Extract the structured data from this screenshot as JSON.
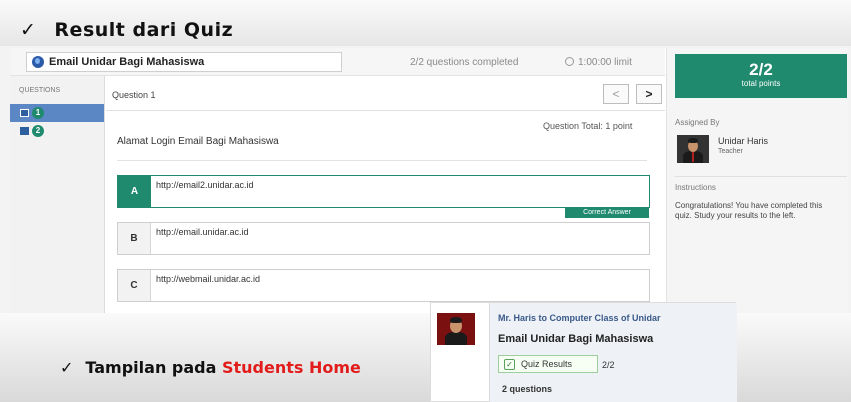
{
  "slide": {
    "check_glyph": "✓",
    "title": "Result dari Quiz",
    "bottom_caption_prefix": "Tampilan pada ",
    "bottom_caption_highlight": "Students Home"
  },
  "quiz": {
    "name": "Email Unidar Bagi Mahasiswa",
    "completed": "2/2 questions completed",
    "limit": "1:00:00 limit",
    "questions_header": "QUESTIONS",
    "questions": [
      {
        "num": "1"
      },
      {
        "num": "2"
      }
    ],
    "current_question_label": "Question 1",
    "prev_label": "<",
    "next_label": ">",
    "question_total": "Question Total: 1 point",
    "question_text": "Alamat Login Email Bagi Mahasiswa",
    "answers": [
      {
        "letter": "A",
        "text": "http://email2.unidar.ac.id",
        "correct": true
      },
      {
        "letter": "B",
        "text": "http://email.unidar.ac.id",
        "correct": false
      },
      {
        "letter": "C",
        "text": "http://webmail.unidar.ac.id",
        "correct": false
      }
    ],
    "correct_answer_label": "Correct Answer"
  },
  "sidebar": {
    "score": "2/2",
    "score_label": "total points",
    "assigned_by_label": "Assigned By",
    "teacher_name": "Unidar Haris",
    "teacher_role": "Teacher",
    "instructions_label": "Instructions",
    "instructions_text": "Congratulations! You have completed this quiz. Study your results to the left."
  },
  "home": {
    "from": "Mr. Haris to Computer Class of Unidar",
    "title": "Email Unidar Bagi Mahasiswa",
    "button_label": "Quiz Results",
    "score": "2/2",
    "count": "2 questions"
  },
  "colors": {
    "accent": "#1f8a6e",
    "highlight": "#e21b1b",
    "link": "#3a5a8a"
  }
}
